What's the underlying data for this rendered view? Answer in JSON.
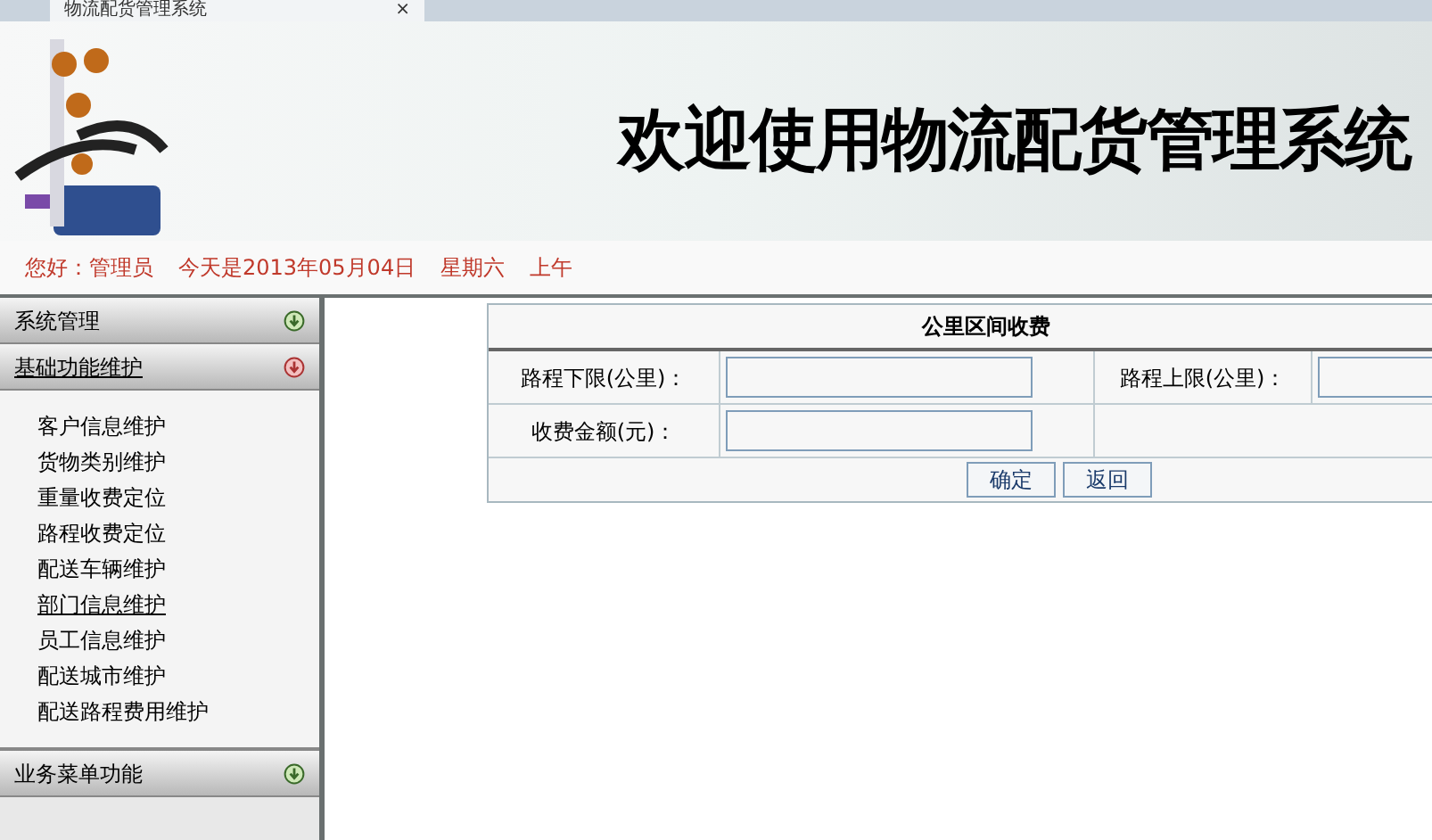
{
  "browser_tab": {
    "title": "物流配货管理系统",
    "close": "×"
  },
  "banner": {
    "title": "欢迎使用物流配货管理系统"
  },
  "info_bar": {
    "greeting": "您好：管理员",
    "date": "今天是2013年05月04日",
    "weekday": "星期六",
    "period": "上午"
  },
  "sidebar": {
    "sections": [
      {
        "label": "系统管理",
        "expanded": false
      },
      {
        "label": "基础功能维护",
        "expanded": true,
        "items": [
          {
            "label": "客户信息维护",
            "selected": false
          },
          {
            "label": "货物类别维护",
            "selected": false
          },
          {
            "label": "重量收费定位",
            "selected": false
          },
          {
            "label": "路程收费定位",
            "selected": false
          },
          {
            "label": "配送车辆维护",
            "selected": false
          },
          {
            "label": "部门信息维护",
            "selected": true
          },
          {
            "label": "员工信息维护",
            "selected": false
          },
          {
            "label": "配送城市维护",
            "selected": false
          },
          {
            "label": "配送路程费用维护",
            "selected": false
          }
        ]
      },
      {
        "label": "业务菜单功能",
        "expanded": false
      }
    ]
  },
  "form": {
    "title": "公里区间收费",
    "rows": [
      [
        {
          "label": "路程下限(公里)："
        },
        {
          "label": "路程上限(公里)："
        }
      ],
      [
        {
          "label": "收费金额(元)："
        }
      ]
    ],
    "buttons": [
      "确定",
      "返回"
    ]
  }
}
